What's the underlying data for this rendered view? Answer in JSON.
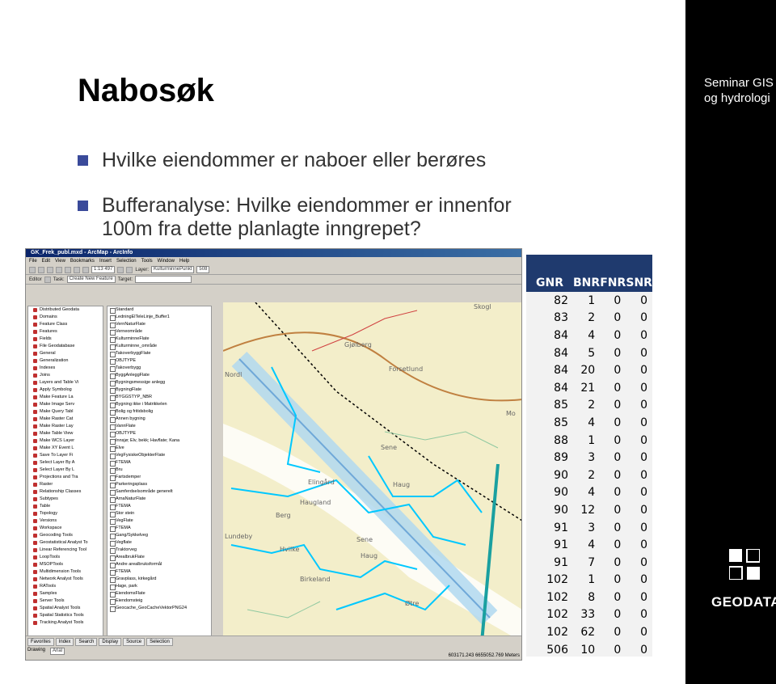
{
  "slide": {
    "title": "Nabosøk",
    "subtitle_line1": "Seminar GIS",
    "subtitle_line2": "og hydrologi",
    "bullets": [
      "Hvilke eiendommer er naboer eller berøres",
      "Bufferanalyse: Hvilke eiendommer er innenfor",
      "100m fra dette planlagte inngrepet?"
    ],
    "logo_text": "GEODATA"
  },
  "app": {
    "title": "GK_Frek_publ.mxd - ArcMap - ArcInfo",
    "menu": [
      "File",
      "Edit",
      "View",
      "Bookmarks",
      "Insert",
      "Selection",
      "Tools",
      "Window",
      "Help"
    ],
    "scale": "1:13 497",
    "layer_label": "Layer:",
    "layer_value": "KulturminnePunkt",
    "scale2": "508",
    "editor_label": "Editor",
    "task_label": "Task:",
    "task_value": "Create New Feature",
    "target_label": "Target:",
    "toolbox_items": [
      "Distributed Geodata",
      "Domains",
      "Feature Class",
      "Features",
      "Fields",
      "File Geodatabase",
      "General",
      "Generalization",
      "Indexes",
      "Joins",
      "Layers and Table Vi",
      "Apply Symbolog",
      "Make Feature La",
      "Make Image Serv",
      "Make Query Tabl",
      "Make Raster Cat",
      "Make Raster Lay",
      "Make Table View",
      "Make WCS Layer",
      "Make XY Event L",
      "Save To Layer Fi",
      "Select Layer By A",
      "Select Layer By L",
      "Projections and Tra",
      "Raster",
      "Relationship Classes",
      "Subtypes",
      "Table",
      "Topology",
      "Versions",
      "Workspace",
      "Geocoding Tools",
      "Geostatistical Analyst To",
      "Linear Referencing Tool",
      "LoopTools",
      "MSOPTools",
      "Multidimension Tools",
      "Network Analyst Tools",
      "RATools",
      "Samples",
      "Server Tools",
      "Spatial Analyst Tools",
      "Spatial Statistics Tools",
      "Tracking Analyst Tools"
    ],
    "toc_items": [
      "Standard",
      "LedningElTeleLinje_Buffer1",
      "VernNaturFlate",
      "Verneområde",
      "KulturminneFlate",
      "Kulturminne_område",
      "TakoverbyggFlate",
      "OBJTYPE",
      "Takoverbygg",
      "ByggAnleggFlate",
      "Bygningsmessige anlegg",
      "BygningFlate",
      "BYGGSTYP_NBR",
      "Bygning ikke i Matrikkelen",
      "Bolig og fritidsbolig",
      "Annen bygning",
      "VannFlate",
      "OBJTYPE",
      "Innsjø; Elv, bekk; Havflate; Kana",
      "Elve",
      "VegFysiskeObjekterFlate",
      "FTEMA",
      "Bru",
      "Fartsdemper",
      "Parkeringsplass",
      "Samferdselsområde generelt",
      "ArnaNaturFlate",
      "FTEMA",
      "Stor stein",
      "VegFlate",
      "FTEMA",
      "Gang/Sykkelveg",
      "Vegflate",
      "Traktorveg",
      "ArealbrukFlate",
      "Andre arealbruksformål",
      "FTEMA",
      "Gravplass, kirkegård",
      "Hage, park",
      "EiendomsFlate",
      "Eiendomsteig",
      "Geocache_GeoCacheVektorPNG24"
    ],
    "tabs": [
      "Favorites",
      "Index",
      "Search",
      "Display",
      "Source",
      "Selection"
    ],
    "drawing_label": "Drawing",
    "font_label": "Arial",
    "coords": "603171.243 6655052.769 Meters",
    "map_labels": [
      "Skogl",
      "Gjølberg",
      "Forsetlund",
      "Mo",
      "Nordl",
      "Sene",
      "Elingård",
      "Haug",
      "Haugland",
      "Berg",
      "Lundeby",
      "Hvilke",
      "Sene",
      "Haug",
      "Birkeland",
      "Øtre"
    ]
  },
  "table": {
    "headers": [
      "GNR",
      "BNR",
      "FNR",
      "SNR"
    ],
    "rows": [
      [
        "82",
        "1",
        "0",
        "0"
      ],
      [
        "83",
        "2",
        "0",
        "0"
      ],
      [
        "84",
        "4",
        "0",
        "0"
      ],
      [
        "84",
        "5",
        "0",
        "0"
      ],
      [
        "84",
        "20",
        "0",
        "0"
      ],
      [
        "84",
        "21",
        "0",
        "0"
      ],
      [
        "85",
        "2",
        "0",
        "0"
      ],
      [
        "85",
        "4",
        "0",
        "0"
      ],
      [
        "88",
        "1",
        "0",
        "0"
      ],
      [
        "89",
        "3",
        "0",
        "0"
      ],
      [
        "90",
        "2",
        "0",
        "0"
      ],
      [
        "90",
        "4",
        "0",
        "0"
      ],
      [
        "90",
        "12",
        "0",
        "0"
      ],
      [
        "91",
        "3",
        "0",
        "0"
      ],
      [
        "91",
        "4",
        "0",
        "0"
      ],
      [
        "91",
        "7",
        "0",
        "0"
      ],
      [
        "102",
        "1",
        "0",
        "0"
      ],
      [
        "102",
        "8",
        "0",
        "0"
      ],
      [
        "102",
        "33",
        "0",
        "0"
      ],
      [
        "102",
        "62",
        "0",
        "0"
      ],
      [
        "506",
        "10",
        "0",
        "0"
      ]
    ]
  },
  "colors": {
    "header_bg": "#1f3a6e",
    "bullet": "#3a4a9a",
    "band": "#000000",
    "map_bg": "#f3eeca",
    "buffer": "#b0d8f0",
    "parcel": "#00c8ff"
  }
}
